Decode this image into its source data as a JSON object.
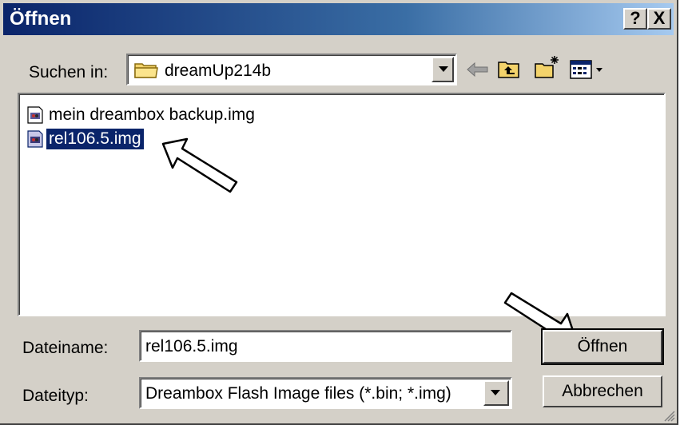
{
  "window": {
    "title": "Öffnen"
  },
  "title_buttons": {
    "help": "?",
    "close": "X"
  },
  "look_in": {
    "label": "Suchen in:",
    "value": "dreamUp214b"
  },
  "toolbar": {
    "back": "back-arrow-icon",
    "up": "folder-up-icon",
    "new_folder": "new-folder-icon",
    "view_menu": "view-menu-icon"
  },
  "files": [
    {
      "name": "mein dreambox backup.img",
      "selected": false
    },
    {
      "name": "rel106.5.img",
      "selected": true
    }
  ],
  "filename": {
    "label": "Dateiname:",
    "value": "rel106.5.img"
  },
  "filetype": {
    "label": "Dateityp:",
    "value": "Dreambox Flash Image files (*.bin; *.img)"
  },
  "buttons": {
    "open": "Öffnen",
    "cancel": "Abbrechen"
  },
  "colors": {
    "title_start": "#0a246a",
    "title_end": "#a6caf0",
    "face": "#d4d0c8",
    "selection": "#0a246a"
  }
}
